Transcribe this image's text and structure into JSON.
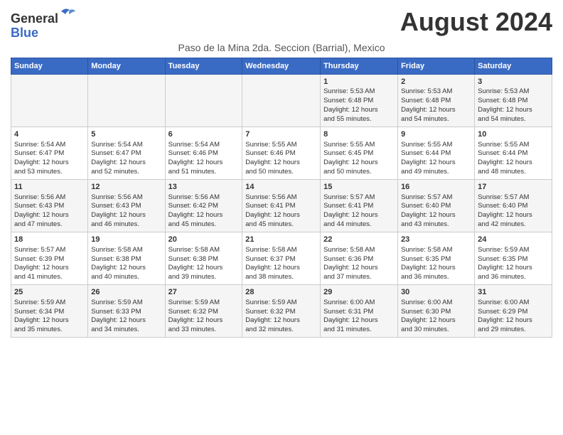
{
  "header": {
    "logo_general": "General",
    "logo_blue": "Blue",
    "month_title": "August 2024",
    "location": "Paso de la Mina 2da. Seccion (Barrial), Mexico"
  },
  "weekdays": [
    "Sunday",
    "Monday",
    "Tuesday",
    "Wednesday",
    "Thursday",
    "Friday",
    "Saturday"
  ],
  "weeks": [
    [
      {
        "day": "",
        "info": ""
      },
      {
        "day": "",
        "info": ""
      },
      {
        "day": "",
        "info": ""
      },
      {
        "day": "",
        "info": ""
      },
      {
        "day": "1",
        "info": "Sunrise: 5:53 AM\nSunset: 6:48 PM\nDaylight: 12 hours\nand 55 minutes."
      },
      {
        "day": "2",
        "info": "Sunrise: 5:53 AM\nSunset: 6:48 PM\nDaylight: 12 hours\nand 54 minutes."
      },
      {
        "day": "3",
        "info": "Sunrise: 5:53 AM\nSunset: 6:48 PM\nDaylight: 12 hours\nand 54 minutes."
      }
    ],
    [
      {
        "day": "4",
        "info": "Sunrise: 5:54 AM\nSunset: 6:47 PM\nDaylight: 12 hours\nand 53 minutes."
      },
      {
        "day": "5",
        "info": "Sunrise: 5:54 AM\nSunset: 6:47 PM\nDaylight: 12 hours\nand 52 minutes."
      },
      {
        "day": "6",
        "info": "Sunrise: 5:54 AM\nSunset: 6:46 PM\nDaylight: 12 hours\nand 51 minutes."
      },
      {
        "day": "7",
        "info": "Sunrise: 5:55 AM\nSunset: 6:46 PM\nDaylight: 12 hours\nand 50 minutes."
      },
      {
        "day": "8",
        "info": "Sunrise: 5:55 AM\nSunset: 6:45 PM\nDaylight: 12 hours\nand 50 minutes."
      },
      {
        "day": "9",
        "info": "Sunrise: 5:55 AM\nSunset: 6:44 PM\nDaylight: 12 hours\nand 49 minutes."
      },
      {
        "day": "10",
        "info": "Sunrise: 5:55 AM\nSunset: 6:44 PM\nDaylight: 12 hours\nand 48 minutes."
      }
    ],
    [
      {
        "day": "11",
        "info": "Sunrise: 5:56 AM\nSunset: 6:43 PM\nDaylight: 12 hours\nand 47 minutes."
      },
      {
        "day": "12",
        "info": "Sunrise: 5:56 AM\nSunset: 6:43 PM\nDaylight: 12 hours\nand 46 minutes."
      },
      {
        "day": "13",
        "info": "Sunrise: 5:56 AM\nSunset: 6:42 PM\nDaylight: 12 hours\nand 45 minutes."
      },
      {
        "day": "14",
        "info": "Sunrise: 5:56 AM\nSunset: 6:41 PM\nDaylight: 12 hours\nand 45 minutes."
      },
      {
        "day": "15",
        "info": "Sunrise: 5:57 AM\nSunset: 6:41 PM\nDaylight: 12 hours\nand 44 minutes."
      },
      {
        "day": "16",
        "info": "Sunrise: 5:57 AM\nSunset: 6:40 PM\nDaylight: 12 hours\nand 43 minutes."
      },
      {
        "day": "17",
        "info": "Sunrise: 5:57 AM\nSunset: 6:40 PM\nDaylight: 12 hours\nand 42 minutes."
      }
    ],
    [
      {
        "day": "18",
        "info": "Sunrise: 5:57 AM\nSunset: 6:39 PM\nDaylight: 12 hours\nand 41 minutes."
      },
      {
        "day": "19",
        "info": "Sunrise: 5:58 AM\nSunset: 6:38 PM\nDaylight: 12 hours\nand 40 minutes."
      },
      {
        "day": "20",
        "info": "Sunrise: 5:58 AM\nSunset: 6:38 PM\nDaylight: 12 hours\nand 39 minutes."
      },
      {
        "day": "21",
        "info": "Sunrise: 5:58 AM\nSunset: 6:37 PM\nDaylight: 12 hours\nand 38 minutes."
      },
      {
        "day": "22",
        "info": "Sunrise: 5:58 AM\nSunset: 6:36 PM\nDaylight: 12 hours\nand 37 minutes."
      },
      {
        "day": "23",
        "info": "Sunrise: 5:58 AM\nSunset: 6:35 PM\nDaylight: 12 hours\nand 36 minutes."
      },
      {
        "day": "24",
        "info": "Sunrise: 5:59 AM\nSunset: 6:35 PM\nDaylight: 12 hours\nand 36 minutes."
      }
    ],
    [
      {
        "day": "25",
        "info": "Sunrise: 5:59 AM\nSunset: 6:34 PM\nDaylight: 12 hours\nand 35 minutes."
      },
      {
        "day": "26",
        "info": "Sunrise: 5:59 AM\nSunset: 6:33 PM\nDaylight: 12 hours\nand 34 minutes."
      },
      {
        "day": "27",
        "info": "Sunrise: 5:59 AM\nSunset: 6:32 PM\nDaylight: 12 hours\nand 33 minutes."
      },
      {
        "day": "28",
        "info": "Sunrise: 5:59 AM\nSunset: 6:32 PM\nDaylight: 12 hours\nand 32 minutes."
      },
      {
        "day": "29",
        "info": "Sunrise: 6:00 AM\nSunset: 6:31 PM\nDaylight: 12 hours\nand 31 minutes."
      },
      {
        "day": "30",
        "info": "Sunrise: 6:00 AM\nSunset: 6:30 PM\nDaylight: 12 hours\nand 30 minutes."
      },
      {
        "day": "31",
        "info": "Sunrise: 6:00 AM\nSunset: 6:29 PM\nDaylight: 12 hours\nand 29 minutes."
      }
    ]
  ]
}
